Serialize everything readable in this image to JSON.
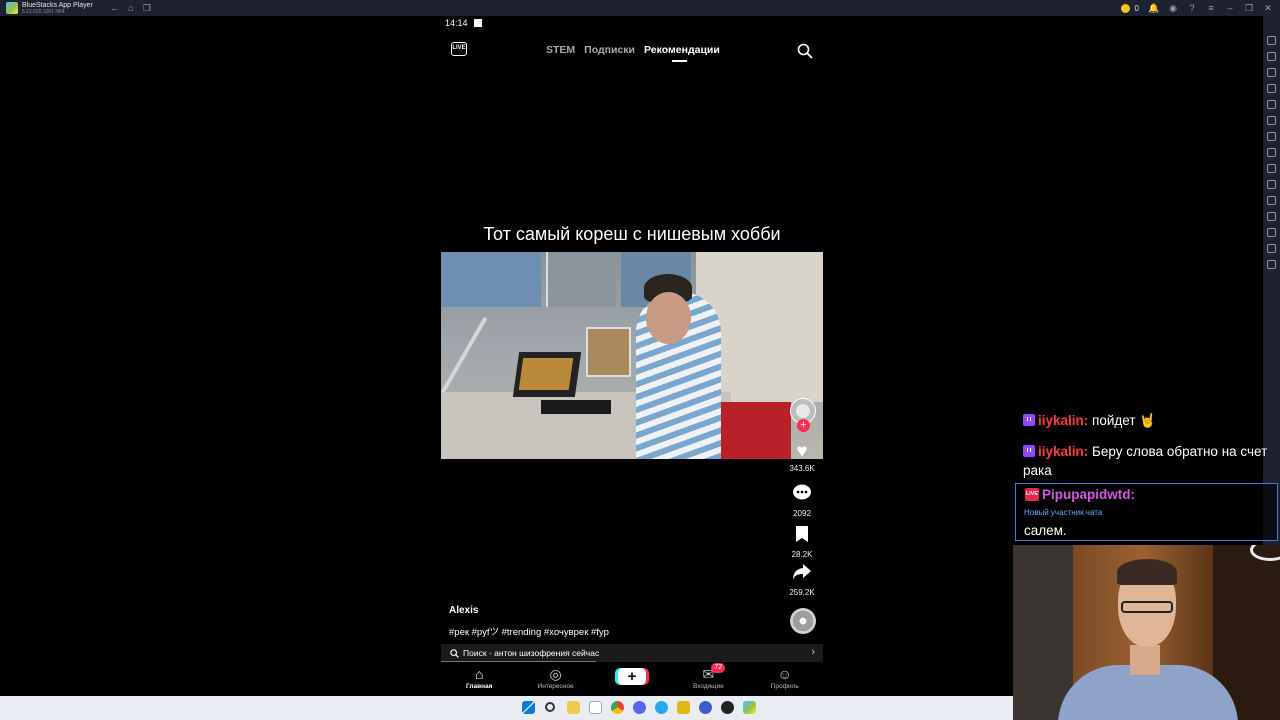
{
  "window": {
    "title": "BlueStacks App Player",
    "subtitle": "5.21.620.1001 N64",
    "coin_count": "0"
  },
  "phone": {
    "time": "14:14",
    "live_label": "LIVE",
    "tabs": [
      {
        "label": "STEM",
        "active": false
      },
      {
        "label": "Подписки",
        "active": false
      },
      {
        "label": "Рекомендации",
        "active": true
      }
    ],
    "caption": "Тот самый кореш с нишевым хобби",
    "actions": {
      "likes": "343.6K",
      "comments": "2092",
      "saves": "28.2K",
      "shares": "259.2K"
    },
    "author": "Alexis",
    "hashtags": "#рек #руfツ #trending #хочуврек #fyp",
    "search_strip": "Поиск · антон шизофрения сейчас",
    "bottom_nav": [
      {
        "label": "Главная",
        "icon": "home-icon",
        "active": true
      },
      {
        "label": "Интересное",
        "icon": "compass-icon",
        "active": false
      },
      {
        "label": "",
        "icon": "plus-icon",
        "active": false
      },
      {
        "label": "Входящие",
        "icon": "inbox-icon",
        "active": false,
        "badge": "72"
      },
      {
        "label": "Профиль",
        "icon": "profile-icon",
        "active": false
      }
    ]
  },
  "chat": [
    {
      "user": "iiykalin:",
      "message": "пойдет 🤘"
    },
    {
      "user": "iiykalin:",
      "message": "Беру слова обратно на счет рака"
    },
    {
      "user": "Pipupapidwtd:",
      "subtitle": "Новый участник чата",
      "message": "салем.",
      "badge": "LIVE"
    }
  ],
  "colors": {
    "accent_red": "#fe2c55",
    "accent_cyan": "#25f4ee",
    "twitch_purple": "#9146ff",
    "chat_user_red": "#ff3b3b",
    "chat_user_pink": "#d25ae0"
  }
}
